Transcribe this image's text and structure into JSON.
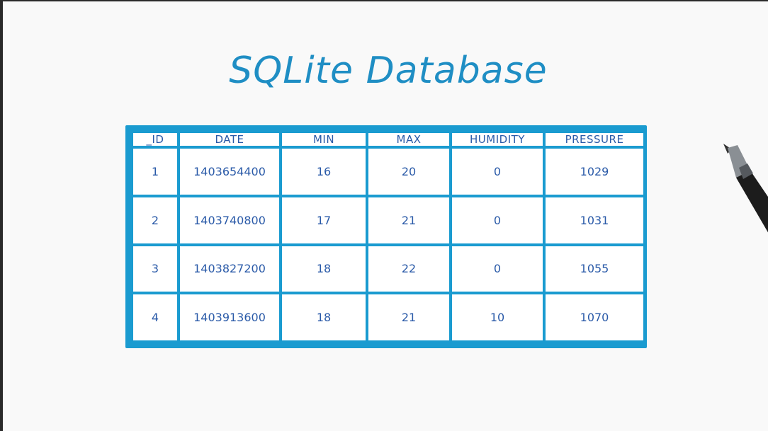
{
  "title": "SQLite Database",
  "colors": {
    "accent": "#1a9bd0",
    "title_text": "#1f8ec4",
    "cell_text": "#2a5aa8",
    "background": "#f9f9f9"
  },
  "table": {
    "columns": [
      "_ID",
      "DATE",
      "MIN",
      "MAX",
      "HUMIDITY",
      "PRESSURE"
    ],
    "rows": [
      [
        "1",
        "1403654400",
        "16",
        "20",
        "0",
        "1029"
      ],
      [
        "2",
        "1403740800",
        "17",
        "21",
        "0",
        "1031"
      ],
      [
        "3",
        "1403827200",
        "18",
        "22",
        "0",
        "1055"
      ],
      [
        "4",
        "1403913600",
        "18",
        "21",
        "10",
        "1070"
      ]
    ]
  },
  "decorations": {
    "pen_icon": "pen-icon"
  }
}
